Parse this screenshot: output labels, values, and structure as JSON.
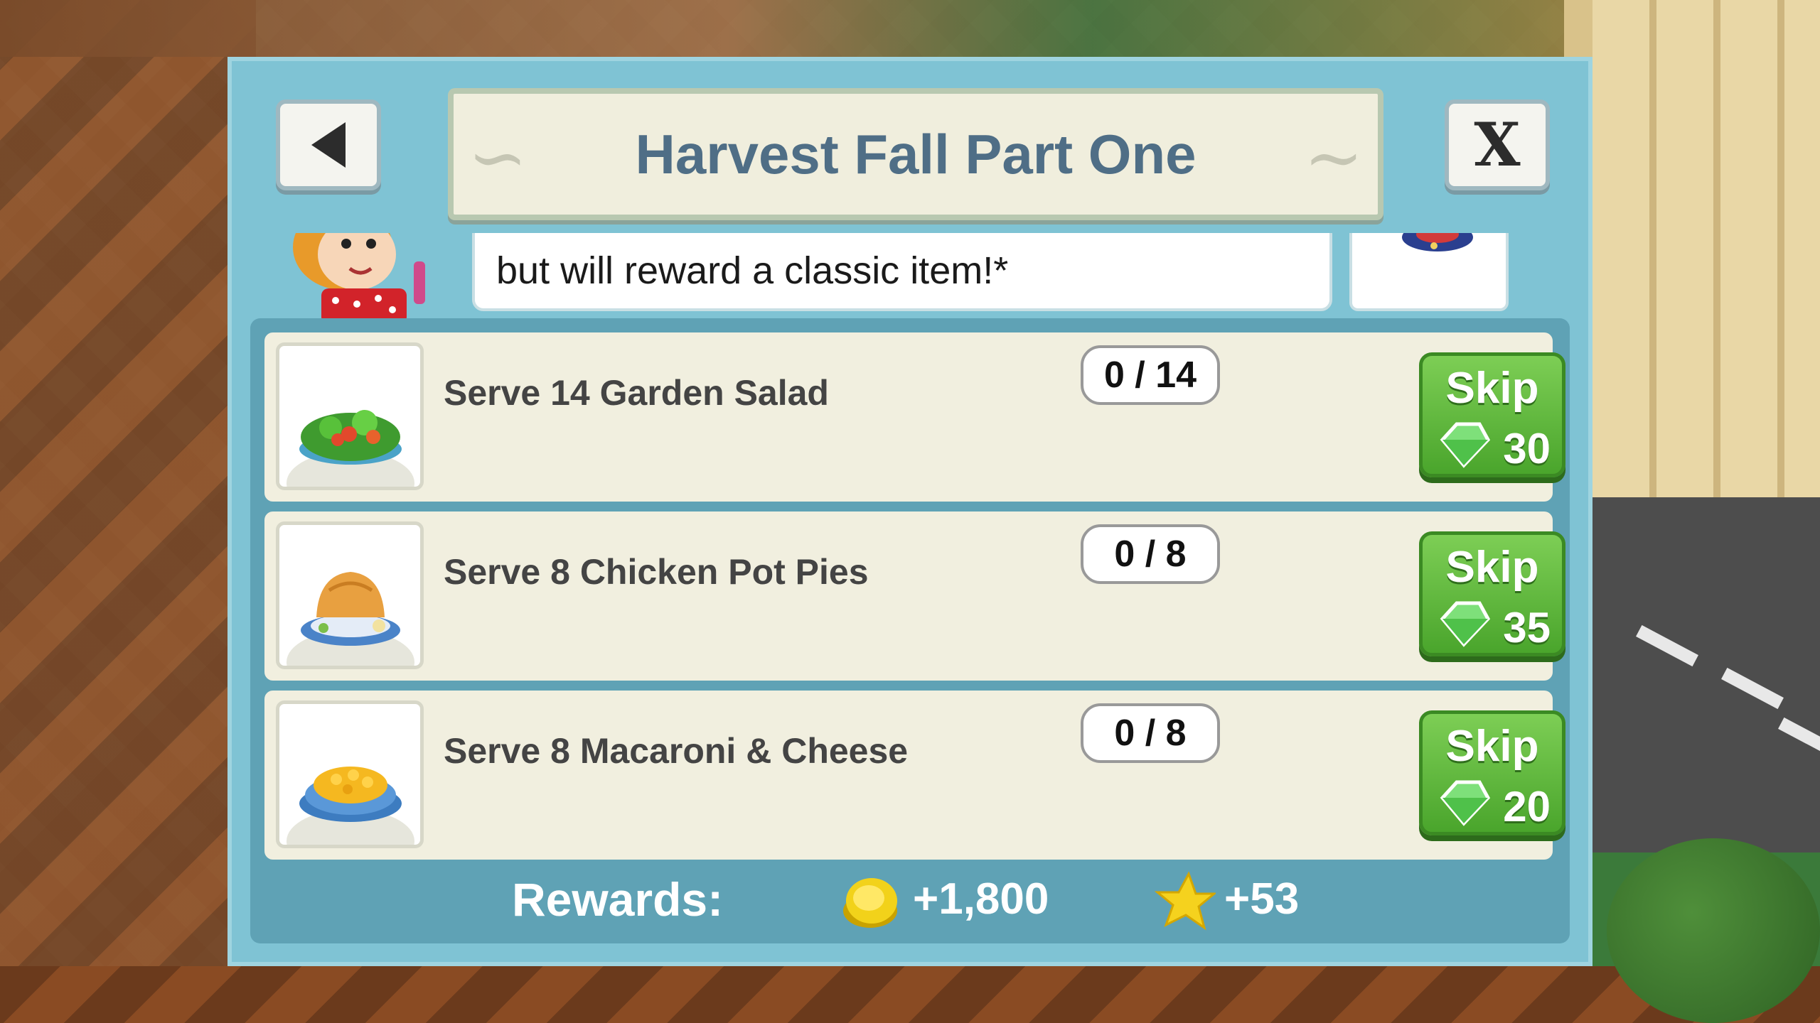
{
  "dialog": {
    "title": "Harvest Fall Part One",
    "speech_text": "but will reward a classic item!*",
    "back_icon": "back-arrow-icon",
    "close_icon": "close-x-icon",
    "close_label": "X"
  },
  "tasks": [
    {
      "label": "Serve 14 Garden Salad",
      "progress": "0 / 14",
      "skip_label": "Skip",
      "skip_cost": "30",
      "icon": "garden-salad-icon"
    },
    {
      "label": "Serve 8 Chicken Pot Pies",
      "progress": "0 / 8",
      "skip_label": "Skip",
      "skip_cost": "35",
      "icon": "chicken-pot-pie-icon"
    },
    {
      "label": "Serve 8 Macaroni & Cheese",
      "progress": "0 / 8",
      "skip_label": "Skip",
      "skip_cost": "20",
      "icon": "macaroni-cheese-icon"
    }
  ],
  "rewards": {
    "label": "Rewards:",
    "coins": "+1,800",
    "stars": "+53",
    "coin_icon": "gold-coins-icon",
    "star_icon": "star-icon"
  },
  "colors": {
    "dialog_bg": "#7fc3d4",
    "inner_bg": "#5fa2b5",
    "title_text": "#4f6e86",
    "skip_green": "#5cb83a"
  }
}
